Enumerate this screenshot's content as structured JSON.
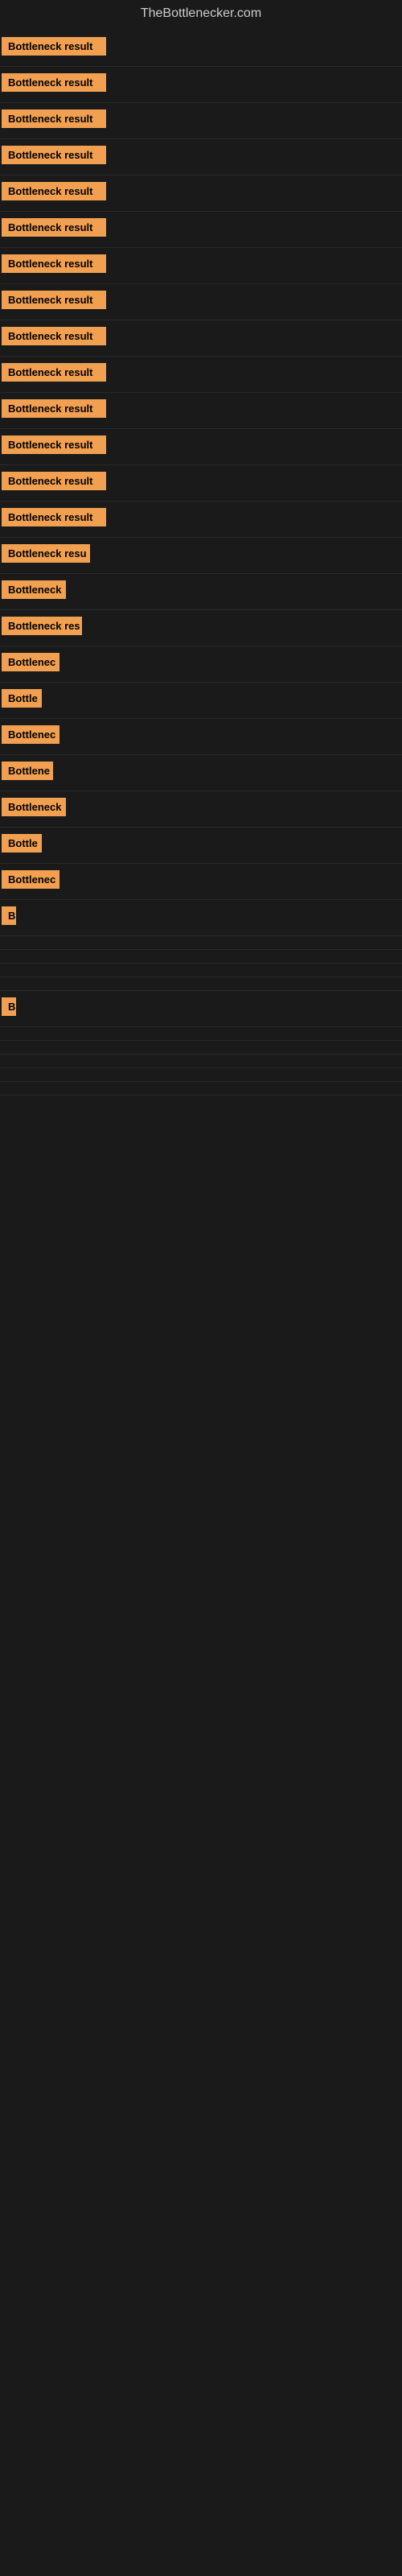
{
  "site": {
    "title": "TheBottlenecker.com"
  },
  "items": [
    {
      "id": 1,
      "label": "Bottleneck result",
      "width": 130
    },
    {
      "id": 2,
      "label": "Bottleneck result",
      "width": 130
    },
    {
      "id": 3,
      "label": "Bottleneck result",
      "width": 130
    },
    {
      "id": 4,
      "label": "Bottleneck result",
      "width": 130
    },
    {
      "id": 5,
      "label": "Bottleneck result",
      "width": 130
    },
    {
      "id": 6,
      "label": "Bottleneck result",
      "width": 130
    },
    {
      "id": 7,
      "label": "Bottleneck result",
      "width": 130
    },
    {
      "id": 8,
      "label": "Bottleneck result",
      "width": 130
    },
    {
      "id": 9,
      "label": "Bottleneck result",
      "width": 130
    },
    {
      "id": 10,
      "label": "Bottleneck result",
      "width": 130
    },
    {
      "id": 11,
      "label": "Bottleneck result",
      "width": 130
    },
    {
      "id": 12,
      "label": "Bottleneck result",
      "width": 130
    },
    {
      "id": 13,
      "label": "Bottleneck result",
      "width": 130
    },
    {
      "id": 14,
      "label": "Bottleneck result",
      "width": 130
    },
    {
      "id": 15,
      "label": "Bottleneck resu",
      "width": 110
    },
    {
      "id": 16,
      "label": "Bottleneck",
      "width": 80
    },
    {
      "id": 17,
      "label": "Bottleneck res",
      "width": 100
    },
    {
      "id": 18,
      "label": "Bottlenec",
      "width": 72
    },
    {
      "id": 19,
      "label": "Bottle",
      "width": 50
    },
    {
      "id": 20,
      "label": "Bottlenec",
      "width": 72
    },
    {
      "id": 21,
      "label": "Bottlene",
      "width": 64
    },
    {
      "id": 22,
      "label": "Bottleneck",
      "width": 80
    },
    {
      "id": 23,
      "label": "Bottle",
      "width": 50
    },
    {
      "id": 24,
      "label": "Bottlenec",
      "width": 72
    },
    {
      "id": 25,
      "label": "B",
      "width": 18
    },
    {
      "id": 26,
      "label": "",
      "width": 0
    },
    {
      "id": 27,
      "label": "",
      "width": 0
    },
    {
      "id": 28,
      "label": "",
      "width": 0
    },
    {
      "id": 29,
      "label": "",
      "width": 0
    },
    {
      "id": 30,
      "label": "B",
      "width": 18
    },
    {
      "id": 31,
      "label": "",
      "width": 0
    },
    {
      "id": 32,
      "label": "",
      "width": 0
    },
    {
      "id": 33,
      "label": "",
      "width": 0
    },
    {
      "id": 34,
      "label": "",
      "width": 0
    },
    {
      "id": 35,
      "label": "",
      "width": 0
    }
  ]
}
